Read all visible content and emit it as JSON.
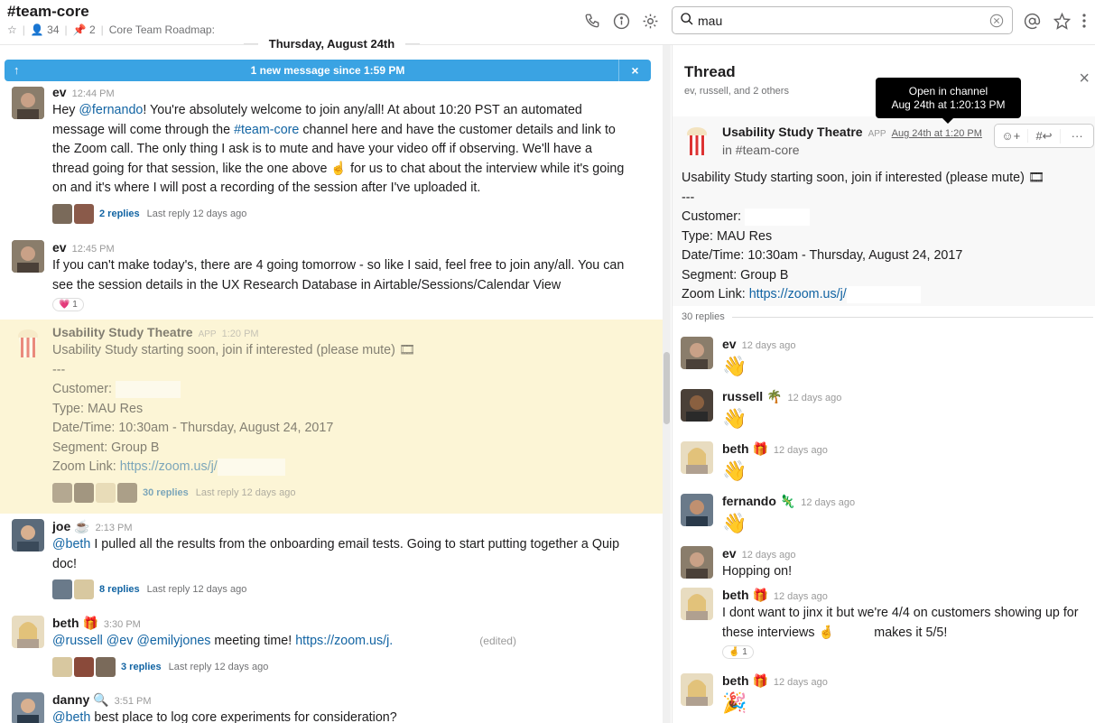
{
  "channel": {
    "name": "#team-core",
    "members": "34",
    "pins": "2",
    "topic": "Core Team Roadmap:"
  },
  "search": {
    "value": "mau"
  },
  "date_divider": "Thursday, August 24th",
  "banner": {
    "text": "1 new message since 1:59 PM",
    "close": "×",
    "arrow": "↑"
  },
  "messages": [
    {
      "name": "ev",
      "time": "12:44 PM",
      "t1": "Hey ",
      "m1": "@fernando",
      "t2": "! You're absolutely welcome to join any/all! At about 10:20 PST an automated message will come through the ",
      "m2": "#team-core",
      "t3": " channel here and have the customer details and link to the Zoom call. The only thing I ask is to mute and have your video off if observing. We'll have a thread going for that session, like the one above ☝ for us to chat about the interview while it's going on and it's where I will post a recording of the session after I've uploaded it.",
      "replies": "2 replies",
      "last_reply": "Last reply 12 days ago"
    },
    {
      "name": "ev",
      "time": "12:45 PM",
      "text": "If you can't make today's, there are 4 going tomorrow - so like I said, feel free to join any/all. You can see the session details in the UX Research Database in Airtable/Sessions/Calendar View",
      "reaction": "1"
    },
    {
      "name": "Usability Study Theatre",
      "tag": "APP",
      "time": "1:20 PM",
      "line1": "Usability Study starting soon, join if interested (please mute) 🎞",
      "line2": "---",
      "line3": "Customer:",
      "line4": "Type: MAU Res",
      "line5": "Date/Time: 10:30am - Thursday, August 24, 2017",
      "line6": "Segment: Group B",
      "line7_label": "Zoom Link: ",
      "line7_link": "https://zoom.us/j/",
      "replies": "30 replies",
      "last_reply": "Last reply 12 days ago"
    },
    {
      "name": "joe ☕",
      "time": "2:13 PM",
      "mention": "@beth",
      "text": " I pulled all the results from the onboarding email tests. Going to start putting together a Quip doc!",
      "replies": "8 replies",
      "last_reply": "Last reply 12 days ago"
    },
    {
      "name": "beth 🎁",
      "time": "3:30 PM",
      "mentions": "@russell @ev @emilyjones",
      "text": " meeting time! ",
      "link": "https://zoom.us/j.",
      "edited": "(edited)",
      "replies": "3 replies",
      "last_reply": "Last reply 12 days ago"
    },
    {
      "name": "danny 🔍",
      "time": "3:51 PM",
      "mention": "@beth",
      "text": " best place to log core experiments for consideration?"
    }
  ],
  "thread": {
    "title": "Thread",
    "subtitle": "ev, russell, and 2 others",
    "close": "×",
    "tooltip_title": "Open in channel",
    "tooltip_time": "Aug 24th at 1:20:13 PM",
    "parent": {
      "name": "Usability Study Theatre",
      "tag": "APP",
      "time": "Aug 24th at 1:20 PM",
      "channel": "in #team-core",
      "line1": "Usability Study starting soon, join if interested (please mute) 🎞",
      "line2": "---",
      "line3": "Customer:",
      "line4": "Type: MAU Res",
      "line5": "Date/Time: 10:30am - Thursday, August 24, 2017",
      "line6": "Segment: Group B",
      "line7_label": "Zoom Link: ",
      "line7_link": "https://zoom.us/j/"
    },
    "actions": [
      "☺+",
      "#↩",
      "···"
    ],
    "replies_count": "30 replies",
    "replies": [
      {
        "name": "ev",
        "time": "12 days ago",
        "text": "👋"
      },
      {
        "name": "russell 🌴",
        "time": "12 days ago",
        "text": "👋"
      },
      {
        "name": "beth 🎁",
        "time": "12 days ago",
        "text": "👋"
      },
      {
        "name": "fernando 🦎",
        "time": "12 days ago",
        "text": "👋"
      },
      {
        "name": "ev",
        "time": "12 days ago",
        "text": "Hopping on!"
      },
      {
        "name": "beth 🎁",
        "time": "12 days ago",
        "text": "I dont want to jinx it but we're 4/4 on customers showing up for these interviews 🤞",
        "text2": "makes it 5/5!",
        "reaction": "1"
      },
      {
        "name": "beth 🎁",
        "time": "12 days ago",
        "text": "🎉"
      }
    ]
  },
  "colors": {
    "accent": "#1264a3",
    "banner": "#3aa3e3",
    "highlight": "#fcf5d6"
  }
}
